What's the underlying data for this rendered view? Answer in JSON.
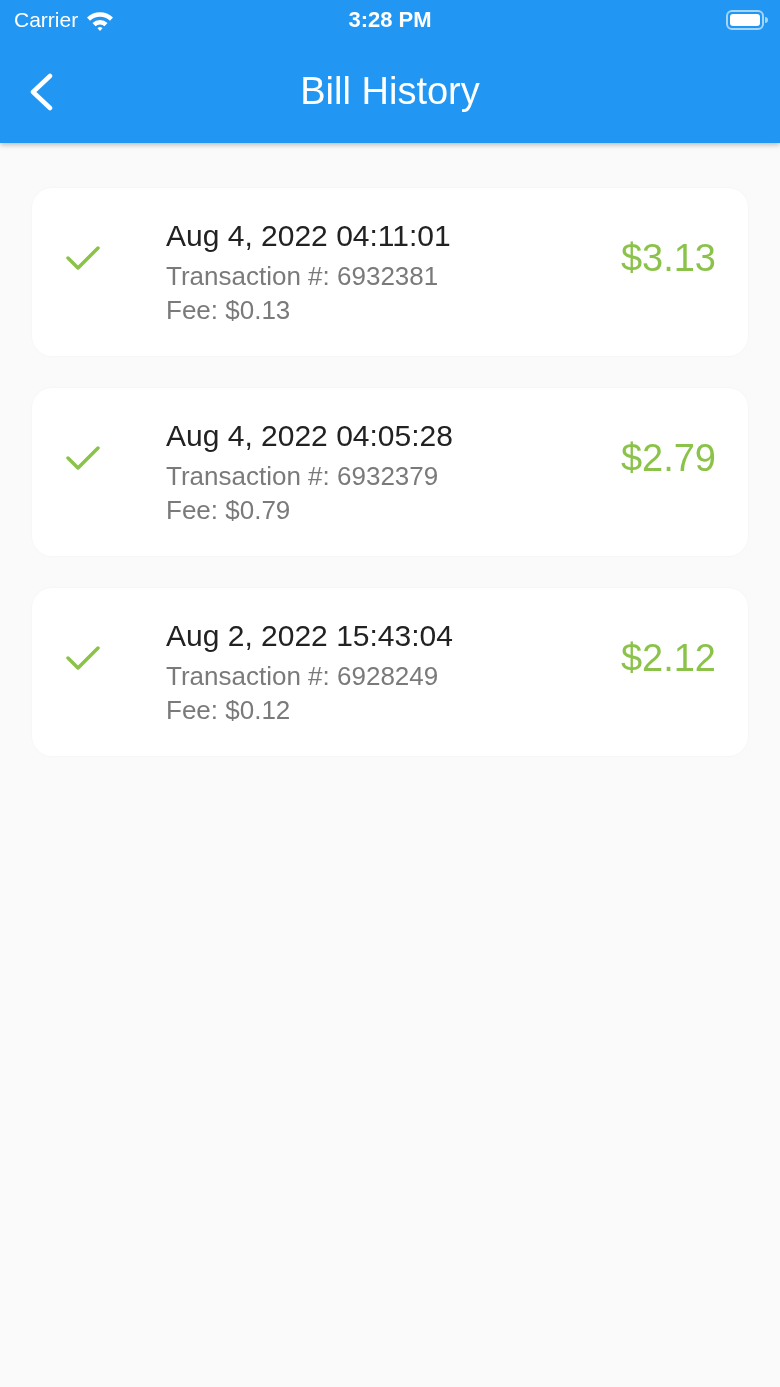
{
  "status_bar": {
    "carrier": "Carrier",
    "time": "3:28 PM"
  },
  "app_bar": {
    "title": "Bill History"
  },
  "bills": [
    {
      "completed": true,
      "date": "Aug 4, 2022 04:11:01",
      "transaction": "Transaction #: 6932381",
      "fee": "Fee: $0.13",
      "amount": "$3.13"
    },
    {
      "completed": true,
      "date": "Aug 4, 2022 04:05:28",
      "transaction": "Transaction #: 6932379",
      "fee": "Fee: $0.79",
      "amount": "$2.79"
    },
    {
      "completed": true,
      "date": "Aug 2, 2022 15:43:04",
      "transaction": "Transaction #: 6928249",
      "fee": "Fee: $0.12",
      "amount": "$2.12"
    }
  ]
}
